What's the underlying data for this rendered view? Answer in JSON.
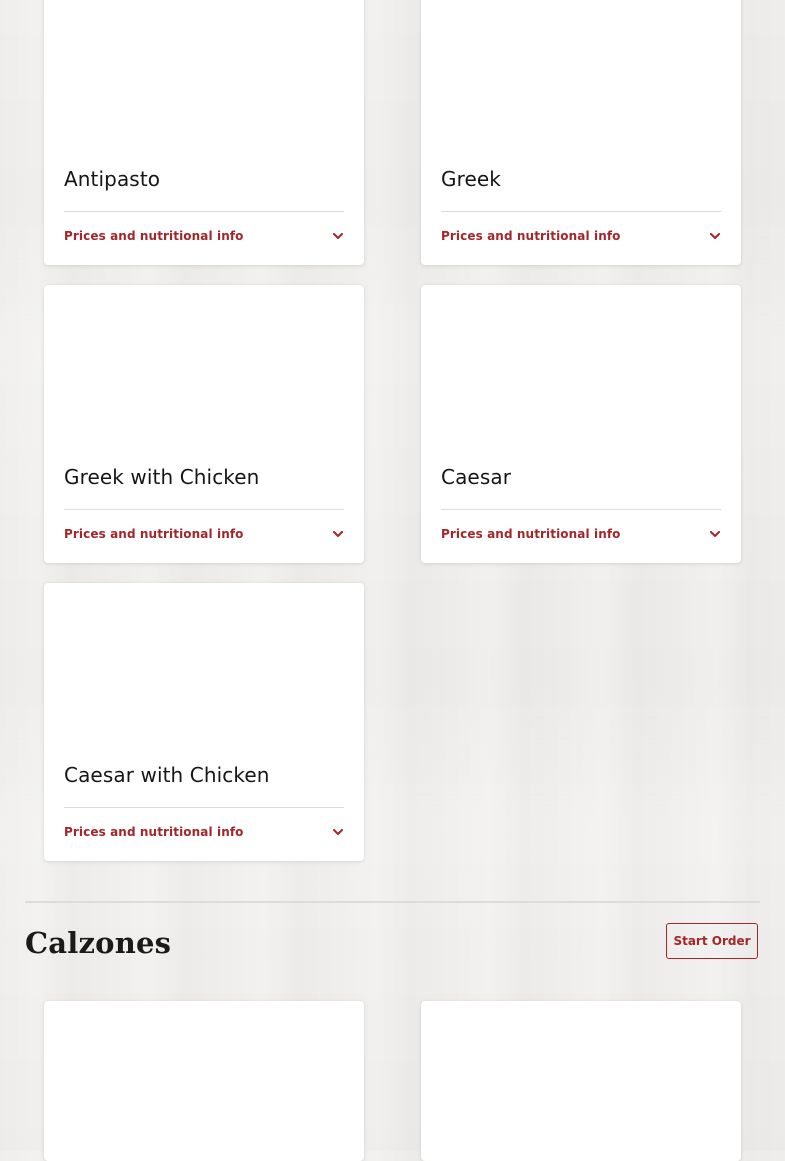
{
  "salads": {
    "items": [
      {
        "name": "Antipasto",
        "toggle_label": "Prices and nutritional info"
      },
      {
        "name": "Greek",
        "toggle_label": "Prices and nutritional info"
      },
      {
        "name": "Greek with Chicken",
        "toggle_label": "Prices and nutritional info"
      },
      {
        "name": "Caesar",
        "toggle_label": "Prices and nutritional info"
      },
      {
        "name": "Caesar with Chicken",
        "toggle_label": "Prices and nutritional info"
      }
    ]
  },
  "calzones": {
    "title": "Calzones",
    "start_order_label": "Start Order"
  },
  "colors": {
    "accent": "#a3262a",
    "card_background": "#ffffff",
    "page_background": "#efeeec"
  },
  "icons": {
    "toggle": "chevron-down-icon"
  }
}
